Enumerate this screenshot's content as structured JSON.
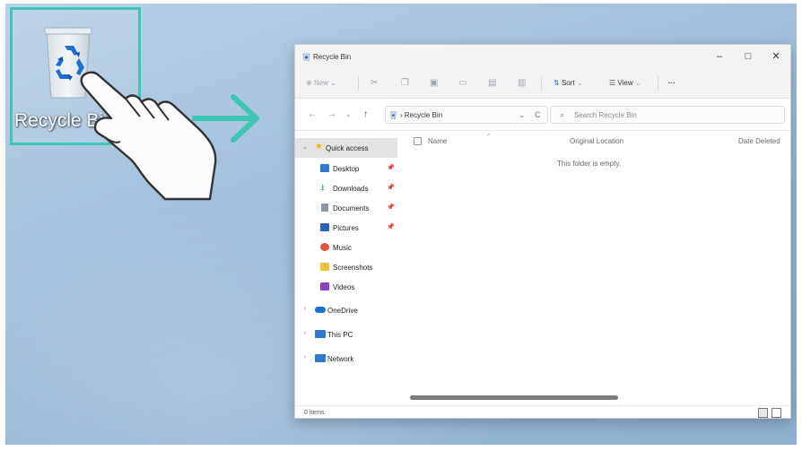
{
  "desktop": {
    "icon_label": "Recycle Bin"
  },
  "window": {
    "title": "Recycle Bin",
    "controls": {
      "minimize": "–",
      "maximize": "□",
      "close": "✕"
    },
    "toolbar": {
      "new_label": "New",
      "sort_label": "Sort",
      "view_label": "View",
      "more_label": "···"
    },
    "address": {
      "back": "←",
      "forward": "→",
      "recent": "⌄",
      "up": "↑",
      "path": "Recycle Bin",
      "refresh": "C",
      "search_placeholder": "Search Recycle Bin"
    },
    "sidebar": {
      "items": [
        {
          "label": "Quick access"
        },
        {
          "label": "Desktop"
        },
        {
          "label": "Downloads"
        },
        {
          "label": "Documents"
        },
        {
          "label": "Pictures"
        },
        {
          "label": "Music"
        },
        {
          "label": "Screenshots"
        },
        {
          "label": "Videos"
        },
        {
          "label": "OneDrive"
        },
        {
          "label": "This PC"
        },
        {
          "label": "Network"
        }
      ]
    },
    "columns": [
      "Name",
      "Original Location",
      "Date Deleted"
    ],
    "empty_message": "This folder is empty.",
    "status": "0 items"
  },
  "colors": {
    "accent_frame": "#3fc6b2",
    "arrow": "#3fc6b2",
    "recycle_blue": "#1e6fd0"
  }
}
